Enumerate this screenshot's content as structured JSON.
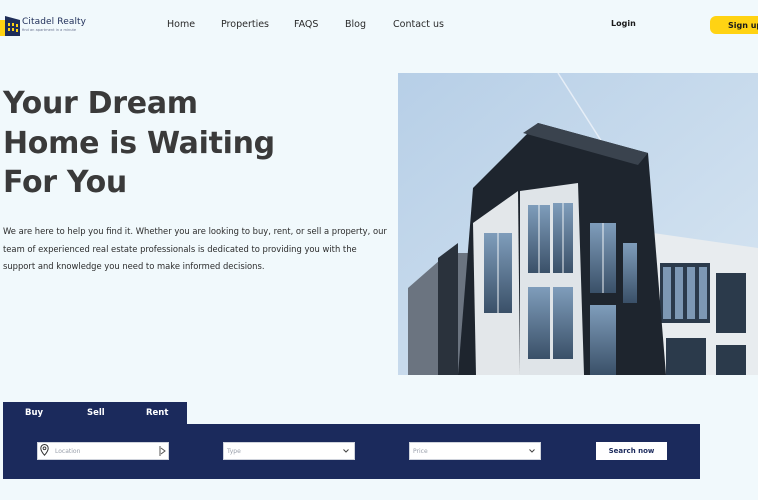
{
  "brand": {
    "name": "Citadel Realty",
    "tagline": "find an apartment in a minute",
    "colors": {
      "navy": "#1b2a5c",
      "accent": "#ffd313"
    }
  },
  "nav": {
    "links": [
      {
        "label": "Home"
      },
      {
        "label": "Properties"
      },
      {
        "label": "FAQS"
      },
      {
        "label": "Blog"
      },
      {
        "label": "Contact us"
      }
    ],
    "login": "Login",
    "signup": "Sign up"
  },
  "hero": {
    "title_lines": [
      "Your Dream",
      "Home is Waiting",
      "For You"
    ],
    "description": "We are here to help you find it. Whether you are looking to buy, rent, or sell a property, our team of experienced real estate professionals is dedicated to providing you with the support and knowledge you need to make informed decisions.",
    "image": "modern-apartment-building-photo"
  },
  "search": {
    "tabs": [
      {
        "label": "Buy"
      },
      {
        "label": "Sell"
      },
      {
        "label": "Rent"
      }
    ],
    "location_placeholder": "Location",
    "type_placeholder": "Type",
    "price_placeholder": "Price",
    "button": "Search now",
    "icons": [
      "location-pin-icon",
      "locate-target-icon",
      "chevron-down-icon"
    ]
  }
}
